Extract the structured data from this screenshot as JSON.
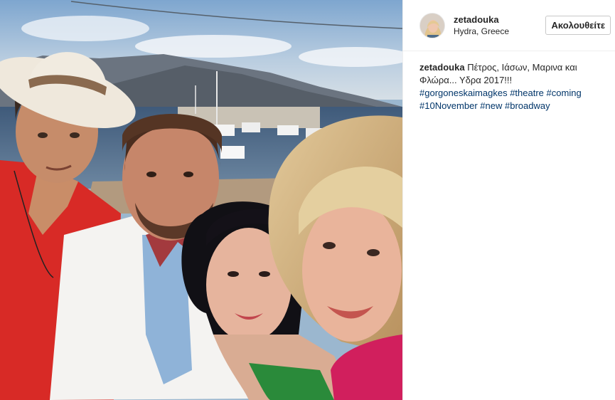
{
  "post": {
    "photo": {
      "alt_icon": "photo-image"
    },
    "author": {
      "username": "zetadouka",
      "location": "Hydra, Greece",
      "avatar_icon": "profile-avatar"
    },
    "follow_button_label": "Ακολουθείτε",
    "caption": {
      "username": "zetadouka",
      "text": "Πέτρος, Ιάσων, Μαρινα και Φλώρα... Υδρα 2017!!!",
      "hashtags": [
        "#gorgoneskaimagkes",
        "#theatre",
        "#coming",
        "#10November",
        "#new",
        "#broadway"
      ]
    }
  },
  "colors": {
    "hashtag": "#003569",
    "text": "#262626",
    "divider": "#efefef"
  }
}
